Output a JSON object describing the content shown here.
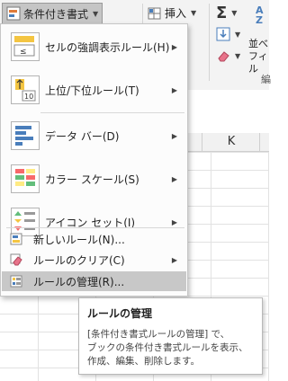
{
  "ribbon": {
    "cf_button": "条件付き書式",
    "insert_button": "挿入",
    "sort_label_line1": "並べ",
    "sort_label_line2": "フィル",
    "group_fragment": "編"
  },
  "sheet": {
    "column_k": "K"
  },
  "menu": {
    "items": [
      {
        "label": "セルの強調表示ルール(H)",
        "has_submenu": true,
        "icon": "highlight-cells-icon"
      },
      {
        "label": "上位/下位ルール(T)",
        "has_submenu": true,
        "icon": "top-bottom-icon"
      },
      {
        "label": "データ バー(D)",
        "has_submenu": true,
        "icon": "data-bars-icon"
      },
      {
        "label": "カラー スケール(S)",
        "has_submenu": true,
        "icon": "color-scales-icon"
      },
      {
        "label": "アイコン セット(I)",
        "has_submenu": true,
        "icon": "icon-sets-icon"
      },
      {
        "label": "新しいルール(N)...",
        "has_submenu": false,
        "icon": "new-rule-icon"
      },
      {
        "label": "ルールのクリア(C)",
        "has_submenu": true,
        "icon": "clear-rules-icon"
      },
      {
        "label": "ルールの管理(R)...",
        "has_submenu": false,
        "icon": "manage-rules-icon"
      }
    ],
    "hovered_item": "ルールの管理(R)..."
  },
  "tooltip": {
    "title": "ルールの管理",
    "line1": "[条件付き書式ルールの管理] で、",
    "line2": "ブックの条件付き書式ルールを表示、",
    "line3": "作成、編集、削除します。"
  },
  "colors": {
    "menu_hover": "#c8c8c8",
    "ribbon_bg": "#f3f3f3",
    "cf_button_pressed": "#c5c5c5"
  }
}
